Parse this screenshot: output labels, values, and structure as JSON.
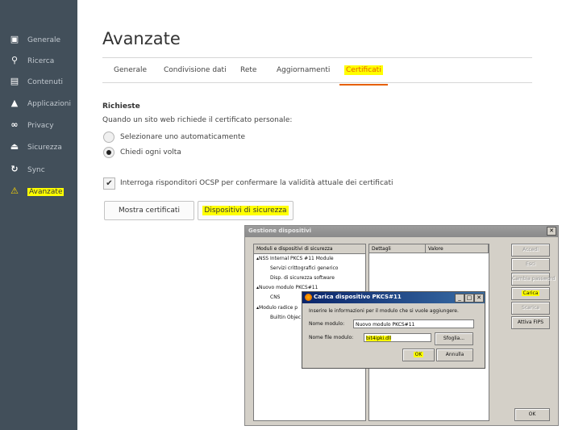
{
  "sidebar": {
    "items": [
      {
        "label": "Generale",
        "icon": "page-icon"
      },
      {
        "label": "Ricerca",
        "icon": "search-icon"
      },
      {
        "label": "Contenuti",
        "icon": "document-icon"
      },
      {
        "label": "Applicazioni",
        "icon": "rocket-icon"
      },
      {
        "label": "Privacy",
        "icon": "mask-icon"
      },
      {
        "label": "Sicurezza",
        "icon": "lock-icon"
      },
      {
        "label": "Sync",
        "icon": "sync-icon"
      },
      {
        "label": "Avanzate",
        "icon": "wizard-icon"
      }
    ]
  },
  "main": {
    "title": "Avanzate",
    "tabs": [
      "Generale",
      "Condivisione dati",
      "Rete",
      "Aggiornamenti",
      "Certificati"
    ],
    "section_title": "Richieste",
    "request_text": "Quando un sito web richiede il certificato personale:",
    "radio_auto": "Selezionare uno automaticamente",
    "radio_ask": "Chiedi ogni volta",
    "ocsp_label": "Interroga risponditori OCSP per confermare la validità attuale dei certificati",
    "btn_show_certs": "Mostra certificati",
    "btn_security_devices": "Dispositivi di sicurezza"
  },
  "device_manager": {
    "title": "Gestione dispositivi",
    "col_modules": "Moduli e dispositivi di sicurezza",
    "col_details": "Dettagli",
    "col_value": "Valore",
    "tree": [
      "▴NSS Internal PKCS #11 Module",
      "Servizi crittografici generico",
      "Disp. di sicurezza software",
      "▴Nuovo modulo PKCS#11",
      "CNS",
      "▴Modulo radice p",
      "Builtin Objec"
    ],
    "buttons": [
      "Accedi",
      "Esci",
      "Cambia password",
      "Carica",
      "Scarica",
      "Attiva FIPS"
    ],
    "ok": "OK"
  },
  "load_dialog": {
    "title": "Carica dispositivo PKCS#11",
    "instructions": "Inserire le informazioni per il modulo che si vuole aggiungere.",
    "name_label": "Nome modulo:",
    "name_value": "Nuovo modulo PKCS#11",
    "file_label": "Nome file modulo:",
    "file_value": "bit4ipki.dll",
    "browse": "Sfoglia...",
    "ok": "OK",
    "cancel": "Annulla"
  }
}
